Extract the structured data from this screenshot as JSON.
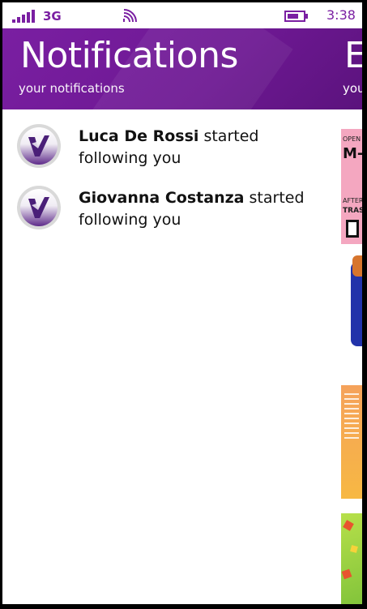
{
  "status_bar": {
    "network": "3G",
    "time": "3:38",
    "signal_icon": "signal-bars-icon",
    "wifi_icon": "wifi-icon",
    "battery_icon": "battery-icon"
  },
  "header": {
    "title": "Notifications",
    "subtitle": "your notifications",
    "next_title_peek": "E",
    "next_subtitle_peek": "you"
  },
  "notifications": [
    {
      "name": "Luca De Rossi",
      "action": " started following you",
      "avatar_icon": "app-logo-icon"
    },
    {
      "name": "Giovanna Costanza",
      "action": " started following you",
      "avatar_icon": "app-logo-icon"
    }
  ],
  "peek_tiles": {
    "tile1_top": "OPEN",
    "tile1_big": "M-",
    "tile1_mid": "AFTERSH",
    "tile1_sub": "TRAS"
  },
  "colors": {
    "accent": "#7a1fa2",
    "header_bg": "#6d1892",
    "text": "#111111",
    "background": "#ffffff"
  }
}
